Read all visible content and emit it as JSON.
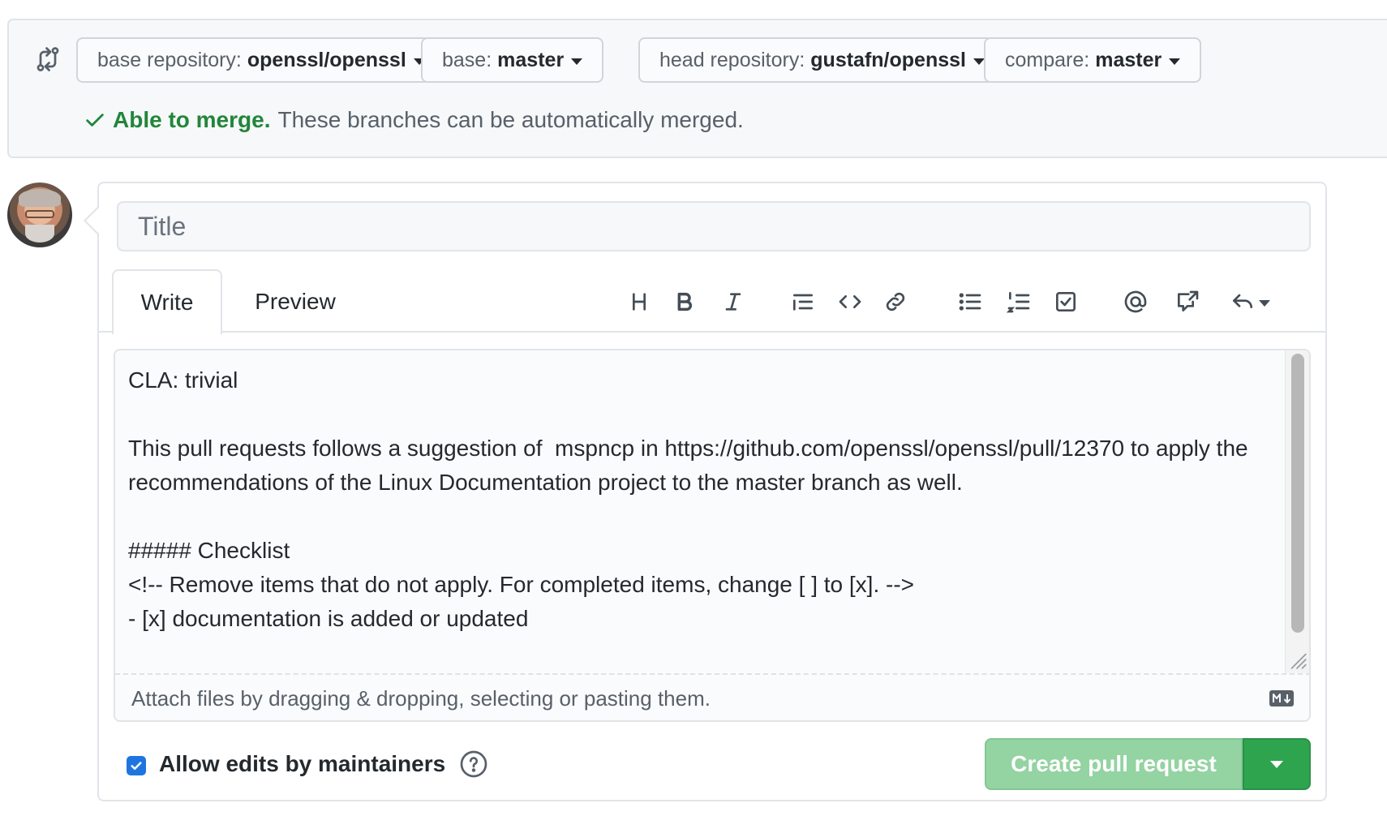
{
  "compare": {
    "base_repo_label": "base repository:",
    "base_repo_value": "openssl/openssl",
    "base_label": "base:",
    "base_value": "master",
    "head_repo_label": "head repository:",
    "head_repo_value": "gustafn/openssl",
    "compare_label": "compare:",
    "compare_value": "master"
  },
  "merge_status": {
    "status": "Able to merge.",
    "message": "These branches can be automatically merged.",
    "color": "#22863a"
  },
  "form": {
    "title_placeholder": "Title",
    "tabs": [
      {
        "label": "Write",
        "active": true
      },
      {
        "label": "Preview",
        "active": false
      }
    ],
    "toolbar_icons": [
      "header-icon",
      "bold-icon",
      "italic-icon",
      "quote-icon",
      "code-icon",
      "link-icon",
      "unordered-list-icon",
      "ordered-list-icon",
      "task-list-icon",
      "mention-icon",
      "cross-reference-icon",
      "reply-icon"
    ],
    "body": "CLA: trivial\n\nThis pull requests follows a suggestion of  mspncp in https://github.com/openssl/openssl/pull/12370 to apply the recommendations of the Linux Documentation project to the master branch as well.\n\n##### Checklist\n<!-- Remove items that do not apply. For completed items, change [ ] to [x]. -->\n- [x] documentation is added or updated",
    "attach_hint": "Attach files by dragging & dropping, selecting or pasting them.",
    "allow_edits_label": "Allow edits by maintainers",
    "allow_edits_checked": true,
    "create_button_label": "Create pull request"
  },
  "colors": {
    "create_button": "#94d3a2",
    "create_caret": "#2ea44f",
    "checkbox": "#1f75e0"
  }
}
